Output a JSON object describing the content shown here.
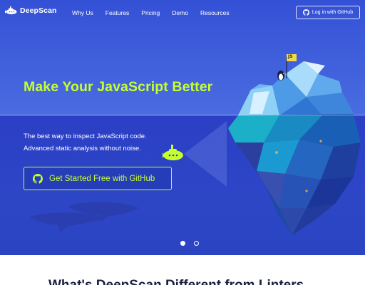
{
  "nav": {
    "logo_text": "DeepScan",
    "links": [
      "Why Us",
      "Features",
      "Pricing",
      "Demo",
      "Resources"
    ],
    "login_label": "Log in with GitHub"
  },
  "hero": {
    "headline": "Make Your JavaScript Better",
    "subtitle_line1": "The best way to inspect JavaScript code.",
    "subtitle_line2": "Advanced static analysis without noise.",
    "cta_label": "Get Started Free with GitHub",
    "flag_text": "JS"
  },
  "carousel": {
    "slides": 2,
    "active_slide": 1
  },
  "section": {
    "heading": "What's DeepScan Different from Linters"
  },
  "colors": {
    "accent": "#c6ff2e",
    "hero_blue": "#3650d8",
    "water_blue": "#2c3fc6",
    "text_white": "#ffffff"
  }
}
